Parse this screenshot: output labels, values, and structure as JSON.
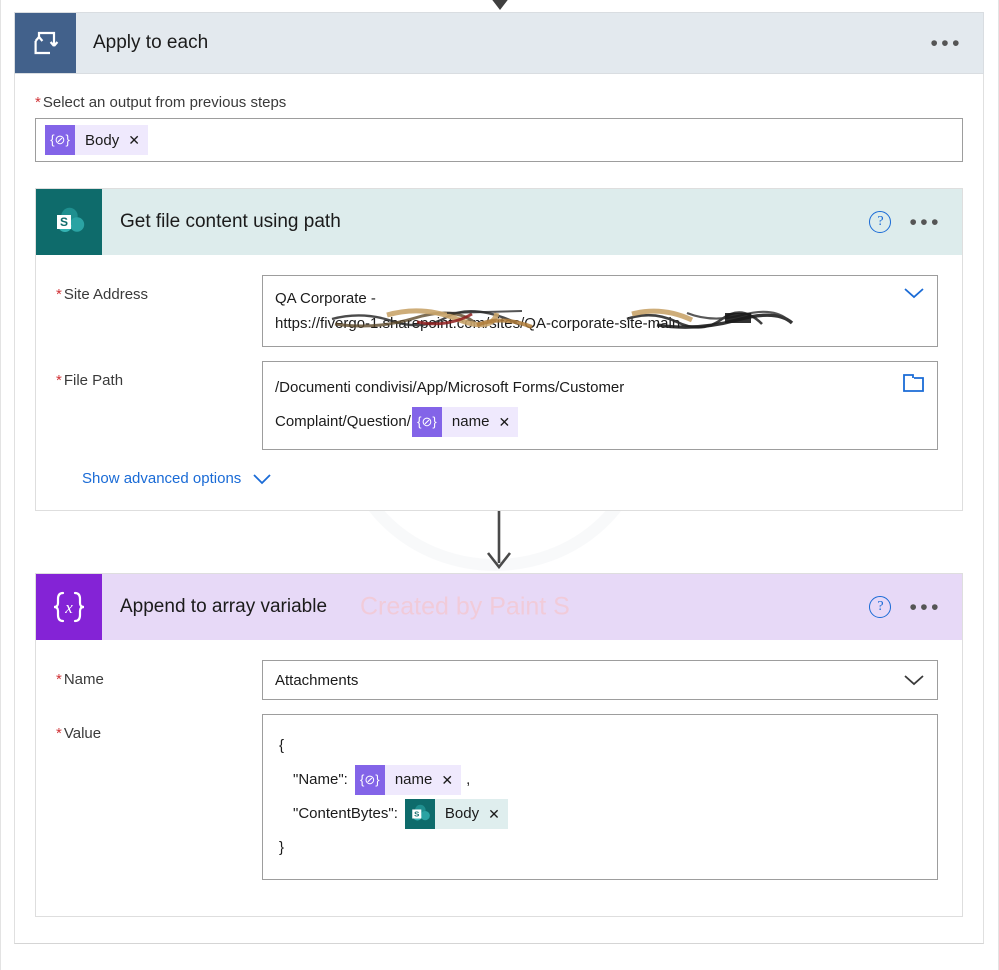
{
  "scope": {
    "title": "Apply to each",
    "icon": "loop-icon",
    "menu": "•••",
    "input_label": "Select an output from previous steps",
    "required_marker": "*",
    "input_token": {
      "icon": "expression-icon",
      "icon_glyph": "{⊘}",
      "label": "Body",
      "remove": "✕"
    }
  },
  "get_file_action": {
    "title": "Get file content using path",
    "icon": "sharepoint-icon",
    "help": "?",
    "menu": "•••",
    "fields": {
      "site_address": {
        "label": "Site Address",
        "required_marker": "*",
        "value_line1": "QA Corporate -",
        "value_line2_prefix": "https://",
        "value_line2_redacted_a": "fivergo-1.sharepoint",
        "value_line2_mid": ".com/sites/Q",
        "value_line2_redacted_b": "A-corporate-site-main",
        "chevron": "chevron-down-icon"
      },
      "file_path": {
        "label": "File Path",
        "required_marker": "*",
        "value_line1": "/Documenti condivisi/App/Microsoft Forms/Customer",
        "value_line2": "Complaint/Question/",
        "token": {
          "icon": "expression-icon",
          "icon_glyph": "{⊘}",
          "label": "name",
          "remove": "✕"
        },
        "picker": "folder-icon"
      }
    },
    "advanced_options_label": "Show advanced options",
    "advanced_options_chevron": "chevron-down-icon"
  },
  "append_action": {
    "title": "Append to array variable",
    "icon": "variable-icon",
    "icon_glyph": "{x}",
    "watermark": "Created by Paint S",
    "help": "?",
    "menu": "•••",
    "fields": {
      "name": {
        "label": "Name",
        "required_marker": "*",
        "value": "Attachments",
        "chevron": "chevron-down-icon"
      },
      "value": {
        "label": "Value",
        "required_marker": "*",
        "open_brace": "{",
        "close_brace": "}",
        "rows": [
          {
            "key": "\"Name\":",
            "token_type": "expr",
            "token_icon_glyph": "{⊘}",
            "token_label": "name",
            "token_remove": "✕",
            "trailing": ","
          },
          {
            "key": "\"ContentBytes\":",
            "token_type": "sp",
            "token_icon_glyph": "sharepoint-icon",
            "token_label": "Body",
            "token_remove": "✕",
            "trailing": ""
          }
        ]
      }
    }
  },
  "colors": {
    "scope_icon_bg": "#42618b",
    "scope_header_bg": "#e3e9ee",
    "sharepoint_teal": "#0e6b6b",
    "sharepoint_header_bg": "#ddecec",
    "variable_purple": "#8423d6",
    "variable_header_bg": "#e7d9f7",
    "token_purple": "#8364e8",
    "token_purple_bg": "#efe9fd",
    "token_teal_bg": "#dfeeee",
    "link_blue": "#1a6bd6",
    "required_red": "#d13438",
    "watermark_pink": "#f3c9d4"
  }
}
